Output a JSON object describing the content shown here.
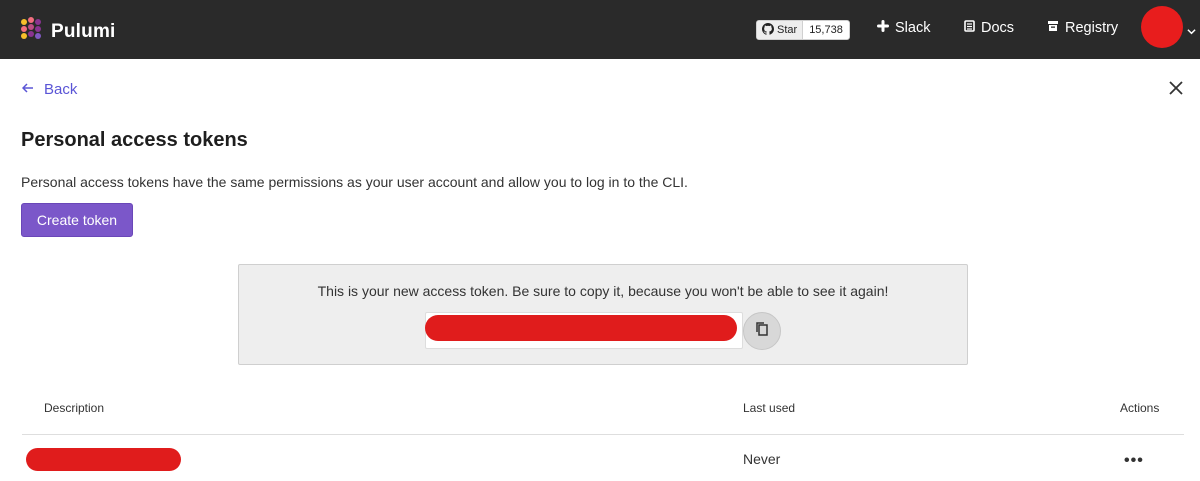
{
  "header": {
    "brand": "Pulumi",
    "github": {
      "star_label": "Star",
      "count": "15,738"
    },
    "nav": [
      {
        "label": "Slack",
        "icon": "slack-icon"
      },
      {
        "label": "Docs",
        "icon": "docs-icon"
      },
      {
        "label": "Registry",
        "icon": "registry-icon"
      }
    ],
    "avatar": "avatar-redacted",
    "colors": {
      "bar": "#2a2a2a",
      "accent": "#7b57c9",
      "link": "#5a55d6"
    }
  },
  "page": {
    "back_label": "Back",
    "title": "Personal access tokens",
    "subtitle": "Personal access tokens have the same permissions as your user account and allow you to log in to the CLI.",
    "create_button": "Create token"
  },
  "token_panel": {
    "message": "This is your new access token. Be sure to copy it, because you won't be able to see it again!",
    "token_value": "",
    "copy_icon": "copy-icon"
  },
  "table": {
    "columns": [
      "Description",
      "Last used",
      "Actions"
    ],
    "rows": [
      {
        "description": "",
        "last_used": "Never",
        "actions": "•••"
      }
    ]
  }
}
